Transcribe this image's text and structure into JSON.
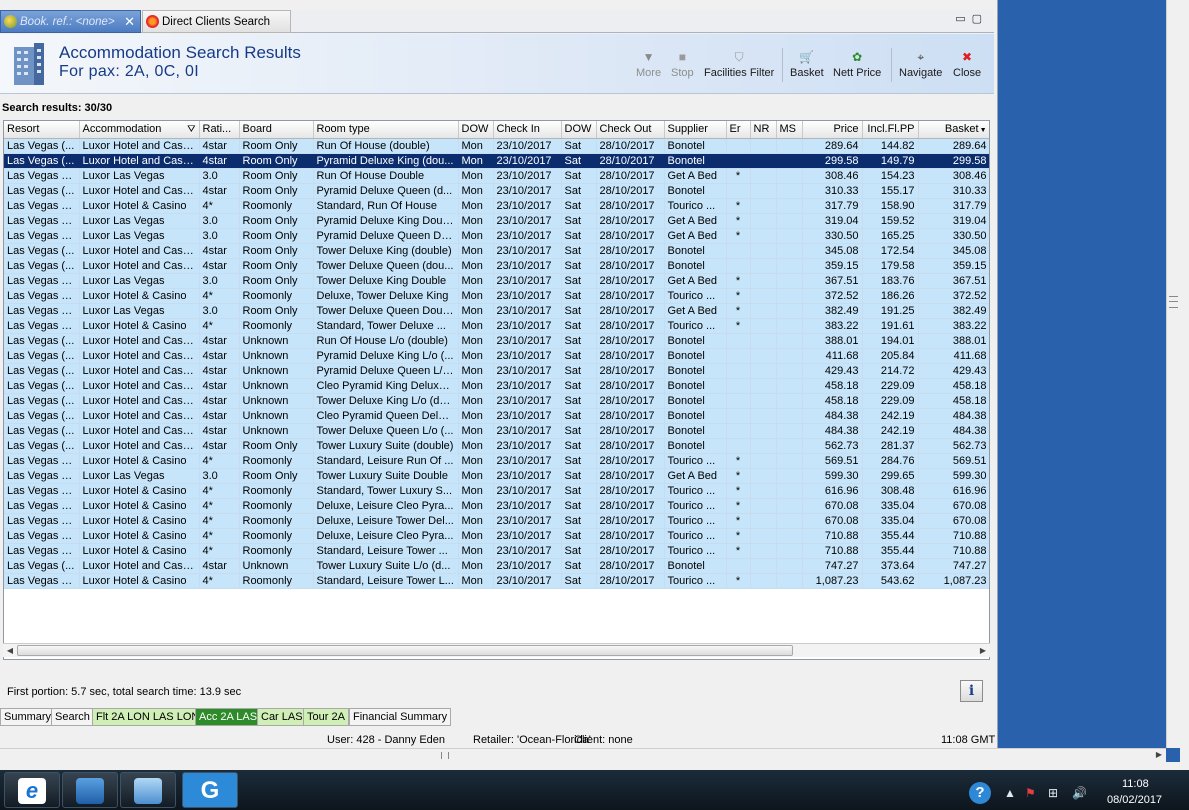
{
  "tabs": [
    {
      "label": "Book. ref.: <none>",
      "closable": true,
      "active": true
    },
    {
      "label": "Direct Clients Search",
      "closable": false,
      "active": false
    }
  ],
  "header": {
    "title": "Accommodation Search Results",
    "subtitle": "For pax: 2A, 0C, 0I"
  },
  "toolbar": {
    "more": "More",
    "stop": "Stop",
    "facilities_filter": "Facilities Filter",
    "basket": "Basket",
    "nett_price": "Nett Price",
    "navigate": "Navigate",
    "close": "Close"
  },
  "results_label": "Search results: 30/30",
  "columns": [
    "Resort",
    "Accommodation",
    "Rati...",
    "Board",
    "Room type",
    "DOW",
    "Check In",
    "DOW",
    "Check Out",
    "Supplier",
    "Er",
    "NR",
    "MS",
    "Price",
    "Incl.Fl.PP",
    "Basket"
  ],
  "rows": [
    [
      "Las Vegas (...",
      "Luxor Hotel and Casino",
      "4star",
      "Room Only",
      "Run Of House (double)",
      "Mon",
      "23/10/2017",
      "Sat",
      "28/10/2017",
      "Bonotel",
      "",
      "",
      "",
      "289.64",
      "144.82",
      "289.64"
    ],
    [
      "Las Vegas (...",
      "Luxor Hotel and Casino",
      "4star",
      "Room Only",
      "Pyramid Deluxe King (dou...",
      "Mon",
      "23/10/2017",
      "Sat",
      "28/10/2017",
      "Bonotel",
      "",
      "",
      "",
      "299.58",
      "149.79",
      "299.58"
    ],
    [
      "Las Vegas T...",
      "Luxor Las Vegas",
      "3.0",
      "Room Only",
      "Run Of House Double",
      "Mon",
      "23/10/2017",
      "Sat",
      "28/10/2017",
      "Get A Bed",
      "*",
      "",
      "",
      "308.46",
      "154.23",
      "308.46"
    ],
    [
      "Las Vegas (...",
      "Luxor Hotel and Casino",
      "4star",
      "Room Only",
      "Pyramid Deluxe Queen (d...",
      "Mon",
      "23/10/2017",
      "Sat",
      "28/10/2017",
      "Bonotel",
      "",
      "",
      "",
      "310.33",
      "155.17",
      "310.33"
    ],
    [
      "Las Vegas T...",
      "Luxor Hotel & Casino",
      "4*",
      "Roomonly",
      "Standard, Run Of House",
      "Mon",
      "23/10/2017",
      "Sat",
      "28/10/2017",
      "Tourico ...",
      "*",
      "",
      "",
      "317.79",
      "158.90",
      "317.79"
    ],
    [
      "Las Vegas T...",
      "Luxor Las Vegas",
      "3.0",
      "Room Only",
      "Pyramid Deluxe King Double",
      "Mon",
      "23/10/2017",
      "Sat",
      "28/10/2017",
      "Get A Bed",
      "*",
      "",
      "",
      "319.04",
      "159.52",
      "319.04"
    ],
    [
      "Las Vegas T...",
      "Luxor Las Vegas",
      "3.0",
      "Room Only",
      "Pyramid Deluxe Queen Do...",
      "Mon",
      "23/10/2017",
      "Sat",
      "28/10/2017",
      "Get A Bed",
      "*",
      "",
      "",
      "330.50",
      "165.25",
      "330.50"
    ],
    [
      "Las Vegas (...",
      "Luxor Hotel and Casino",
      "4star",
      "Room Only",
      "Tower Deluxe King (double)",
      "Mon",
      "23/10/2017",
      "Sat",
      "28/10/2017",
      "Bonotel",
      "",
      "",
      "",
      "345.08",
      "172.54",
      "345.08"
    ],
    [
      "Las Vegas (...",
      "Luxor Hotel and Casino",
      "4star",
      "Room Only",
      "Tower Deluxe Queen (dou...",
      "Mon",
      "23/10/2017",
      "Sat",
      "28/10/2017",
      "Bonotel",
      "",
      "",
      "",
      "359.15",
      "179.58",
      "359.15"
    ],
    [
      "Las Vegas T...",
      "Luxor Las Vegas",
      "3.0",
      "Room Only",
      "Tower Deluxe King Double",
      "Mon",
      "23/10/2017",
      "Sat",
      "28/10/2017",
      "Get A Bed",
      "*",
      "",
      "",
      "367.51",
      "183.76",
      "367.51"
    ],
    [
      "Las Vegas T...",
      "Luxor Hotel & Casino",
      "4*",
      "Roomonly",
      "Deluxe, Tower Deluxe King",
      "Mon",
      "23/10/2017",
      "Sat",
      "28/10/2017",
      "Tourico ...",
      "*",
      "",
      "",
      "372.52",
      "186.26",
      "372.52"
    ],
    [
      "Las Vegas T...",
      "Luxor Las Vegas",
      "3.0",
      "Room Only",
      "Tower Deluxe Queen Double",
      "Mon",
      "23/10/2017",
      "Sat",
      "28/10/2017",
      "Get A Bed",
      "*",
      "",
      "",
      "382.49",
      "191.25",
      "382.49"
    ],
    [
      "Las Vegas T...",
      "Luxor Hotel & Casino",
      "4*",
      "Roomonly",
      "Standard, Tower Deluxe ...",
      "Mon",
      "23/10/2017",
      "Sat",
      "28/10/2017",
      "Tourico ...",
      "*",
      "",
      "",
      "383.22",
      "191.61",
      "383.22"
    ],
    [
      "Las Vegas (...",
      "Luxor Hotel and Casino",
      "4star",
      "Unknown",
      "Run Of House L/o (double)",
      "Mon",
      "23/10/2017",
      "Sat",
      "28/10/2017",
      "Bonotel",
      "",
      "",
      "",
      "388.01",
      "194.01",
      "388.01"
    ],
    [
      "Las Vegas (...",
      "Luxor Hotel and Casino",
      "4star",
      "Unknown",
      "Pyramid Deluxe King L/o (...",
      "Mon",
      "23/10/2017",
      "Sat",
      "28/10/2017",
      "Bonotel",
      "",
      "",
      "",
      "411.68",
      "205.84",
      "411.68"
    ],
    [
      "Las Vegas (...",
      "Luxor Hotel and Casino",
      "4star",
      "Unknown",
      "Pyramid Deluxe Queen L/o...",
      "Mon",
      "23/10/2017",
      "Sat",
      "28/10/2017",
      "Bonotel",
      "",
      "",
      "",
      "429.43",
      "214.72",
      "429.43"
    ],
    [
      "Las Vegas (...",
      "Luxor Hotel and Casino",
      "4star",
      "Unknown",
      "Cleo Pyramid King Deluxe ...",
      "Mon",
      "23/10/2017",
      "Sat",
      "28/10/2017",
      "Bonotel",
      "",
      "",
      "",
      "458.18",
      "229.09",
      "458.18"
    ],
    [
      "Las Vegas (...",
      "Luxor Hotel and Casino",
      "4star",
      "Unknown",
      "Tower Deluxe King L/o (do...",
      "Mon",
      "23/10/2017",
      "Sat",
      "28/10/2017",
      "Bonotel",
      "",
      "",
      "",
      "458.18",
      "229.09",
      "458.18"
    ],
    [
      "Las Vegas (...",
      "Luxor Hotel and Casino",
      "4star",
      "Unknown",
      "Cleo Pyramid Queen Delux...",
      "Mon",
      "23/10/2017",
      "Sat",
      "28/10/2017",
      "Bonotel",
      "",
      "",
      "",
      "484.38",
      "242.19",
      "484.38"
    ],
    [
      "Las Vegas (...",
      "Luxor Hotel and Casino",
      "4star",
      "Unknown",
      "Tower Deluxe Queen L/o (...",
      "Mon",
      "23/10/2017",
      "Sat",
      "28/10/2017",
      "Bonotel",
      "",
      "",
      "",
      "484.38",
      "242.19",
      "484.38"
    ],
    [
      "Las Vegas (...",
      "Luxor Hotel and Casino",
      "4star",
      "Room Only",
      "Tower Luxury Suite (double)",
      "Mon",
      "23/10/2017",
      "Sat",
      "28/10/2017",
      "Bonotel",
      "",
      "",
      "",
      "562.73",
      "281.37",
      "562.73"
    ],
    [
      "Las Vegas T...",
      "Luxor Hotel & Casino",
      "4*",
      "Roomonly",
      "Standard, Leisure Run Of ...",
      "Mon",
      "23/10/2017",
      "Sat",
      "28/10/2017",
      "Tourico ...",
      "*",
      "",
      "",
      "569.51",
      "284.76",
      "569.51"
    ],
    [
      "Las Vegas T...",
      "Luxor Las Vegas",
      "3.0",
      "Room Only",
      "Tower Luxury Suite Double",
      "Mon",
      "23/10/2017",
      "Sat",
      "28/10/2017",
      "Get A Bed",
      "*",
      "",
      "",
      "599.30",
      "299.65",
      "599.30"
    ],
    [
      "Las Vegas T...",
      "Luxor Hotel & Casino",
      "4*",
      "Roomonly",
      "Standard, Tower Luxury S...",
      "Mon",
      "23/10/2017",
      "Sat",
      "28/10/2017",
      "Tourico ...",
      "*",
      "",
      "",
      "616.96",
      "308.48",
      "616.96"
    ],
    [
      "Las Vegas T...",
      "Luxor Hotel & Casino",
      "4*",
      "Roomonly",
      "Deluxe, Leisure Cleo Pyra...",
      "Mon",
      "23/10/2017",
      "Sat",
      "28/10/2017",
      "Tourico ...",
      "*",
      "",
      "",
      "670.08",
      "335.04",
      "670.08"
    ],
    [
      "Las Vegas T...",
      "Luxor Hotel & Casino",
      "4*",
      "Roomonly",
      "Deluxe, Leisure Tower Del...",
      "Mon",
      "23/10/2017",
      "Sat",
      "28/10/2017",
      "Tourico ...",
      "*",
      "",
      "",
      "670.08",
      "335.04",
      "670.08"
    ],
    [
      "Las Vegas T...",
      "Luxor Hotel & Casino",
      "4*",
      "Roomonly",
      "Deluxe, Leisure Cleo Pyra...",
      "Mon",
      "23/10/2017",
      "Sat",
      "28/10/2017",
      "Tourico ...",
      "*",
      "",
      "",
      "710.88",
      "355.44",
      "710.88"
    ],
    [
      "Las Vegas T...",
      "Luxor Hotel & Casino",
      "4*",
      "Roomonly",
      "Standard, Leisure Tower ...",
      "Mon",
      "23/10/2017",
      "Sat",
      "28/10/2017",
      "Tourico ...",
      "*",
      "",
      "",
      "710.88",
      "355.44",
      "710.88"
    ],
    [
      "Las Vegas (...",
      "Luxor Hotel and Casino",
      "4star",
      "Unknown",
      "Tower Luxury Suite L/o (d...",
      "Mon",
      "23/10/2017",
      "Sat",
      "28/10/2017",
      "Bonotel",
      "",
      "",
      "",
      "747.27",
      "373.64",
      "747.27"
    ],
    [
      "Las Vegas T...",
      "Luxor Hotel & Casino",
      "4*",
      "Roomonly",
      "Standard, Leisure Tower L...",
      "Mon",
      "23/10/2017",
      "Sat",
      "28/10/2017",
      "Tourico ...",
      "*",
      "",
      "",
      "1,087.23",
      "543.62",
      "1,087.23"
    ]
  ],
  "selected_row": 1,
  "search_time": "First portion: 5.7 sec, total search time: 13.9 sec",
  "bottom_tabs": [
    {
      "label": "Summary",
      "style": "plain"
    },
    {
      "label": "Search",
      "style": "plain"
    },
    {
      "label": "Flt 2A LON LAS LON",
      "style": "green"
    },
    {
      "label": "Acc 2A LAS",
      "style": "active"
    },
    {
      "label": "Car LAS",
      "style": "green"
    },
    {
      "label": "Tour 2A",
      "style": "green"
    },
    {
      "label": "Financial Summary",
      "style": "plain"
    }
  ],
  "status": {
    "user": "User: 428 - Danny Eden",
    "retailer": "Retailer: 'Ocean-Florida'",
    "client": "Client: none",
    "time": "11:08 GMT"
  },
  "taskbar": {
    "apps": [
      "internet-explorer",
      "network-computer",
      "file-transfer",
      "g-app"
    ],
    "clock_time": "11:08",
    "clock_date": "08/02/2017"
  },
  "colors": {
    "row_bg": "#c7e5fa",
    "selected_row_bg": "#0b2d6e",
    "title_color": "#163b86",
    "active_tab_green": "#2e8b2a",
    "green_tab": "#cfefb6",
    "desktop": "#2a61ad"
  }
}
